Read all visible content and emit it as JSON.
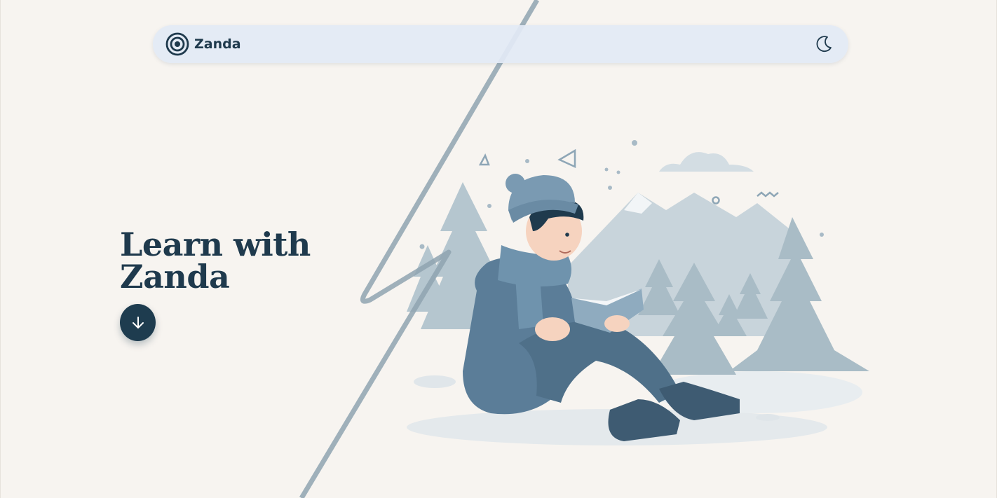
{
  "navbar": {
    "brand_name": "Zanda",
    "logo_icon": "target-rings-icon",
    "theme_toggle_icon": "moon-icon"
  },
  "hero": {
    "title_line1": "Learn with",
    "title_line2": "Zanda",
    "scroll_icon": "arrow-down-icon"
  },
  "illustration": {
    "subject": "person-reading-in-snow-illustration"
  },
  "colors": {
    "background": "#f7f4f0",
    "navbar": "#e2e9f5",
    "text_primary": "#1f3a4d",
    "button": "#1e3c4f",
    "illustration_blue": "#5b7d98",
    "lightning": "#8fa3b0"
  }
}
